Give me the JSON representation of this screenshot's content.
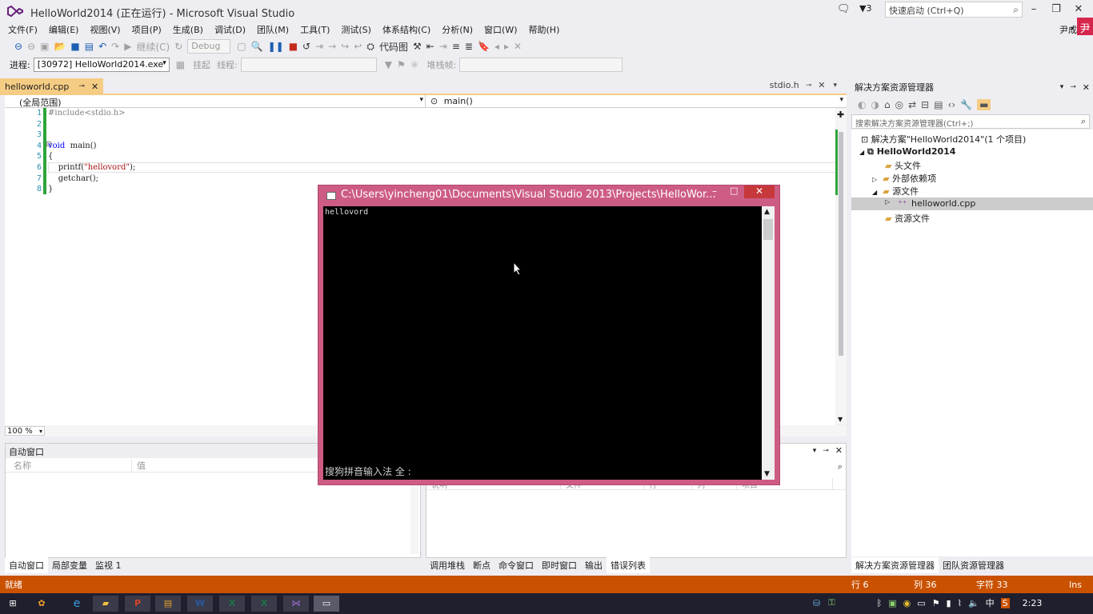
{
  "window": {
    "title": "HelloWorld2014 (正在运行) - Microsoft Visual Studio",
    "notification_count": "3",
    "quick_launch_placeholder": "快速启动 (Ctrl+Q)",
    "user_name": "尹成",
    "user_avatar": "尹"
  },
  "menu": [
    "文件(F)",
    "编辑(E)",
    "视图(V)",
    "项目(P)",
    "生成(B)",
    "调试(D)",
    "团队(M)",
    "工具(T)",
    "测试(S)",
    "体系结构(C)",
    "分析(N)",
    "窗口(W)",
    "帮助(H)"
  ],
  "toolbar1": {
    "continue_label": "继续(C)",
    "config": "Debug",
    "code_map_label": "代码图"
  },
  "toolbar2": {
    "process_label": "进程:",
    "process_value": "[30972] HelloWorld2014.exe",
    "suspend_label": "挂起",
    "thread_label": "线程:",
    "stack_label": "堆栈帧:"
  },
  "editor": {
    "active_tab": "helloworld.cpp",
    "other_tab": "stdio.h",
    "scope": "(全局范围)",
    "function": "main()",
    "zoom": "100 %",
    "line_numbers": [
      "1",
      "2",
      "3",
      "4",
      "5",
      "6",
      "7",
      "8"
    ],
    "lines": [
      {
        "parts": [
          {
            "t": "#include<stdio.h>",
            "c": "pp"
          }
        ]
      },
      {
        "parts": []
      },
      {
        "parts": []
      },
      {
        "parts": [
          {
            "t": "void",
            "c": "kw"
          },
          {
            "t": "  main()",
            "c": ""
          }
        ]
      },
      {
        "parts": [
          {
            "t": "{",
            "c": ""
          }
        ]
      },
      {
        "parts": [
          {
            "t": "    printf(",
            "c": ""
          },
          {
            "t": "\"hellovord\"",
            "c": "str"
          },
          {
            "t": ");",
            "c": ""
          }
        ]
      },
      {
        "parts": [
          {
            "t": "    getchar();",
            "c": ""
          }
        ]
      },
      {
        "parts": [
          {
            "t": "}",
            "c": ""
          }
        ]
      }
    ]
  },
  "auto_window": {
    "title": "自动窗口",
    "col_name": "名称",
    "col_value": "值",
    "tabs": [
      "自动窗口",
      "局部变量",
      "监视 1"
    ]
  },
  "error_list": {
    "columns": [
      "说明",
      "文件",
      "行",
      "列",
      "项目"
    ],
    "tabs": [
      "调用堆栈",
      "断点",
      "命令窗口",
      "即时窗口",
      "输出",
      "错误列表"
    ]
  },
  "solution_explorer": {
    "title": "解决方案资源管理器",
    "search_placeholder": "搜索解决方案资源管理器(Ctrl+;)",
    "solution": "解决方案\"HelloWorld2014\"(1 个项目)",
    "project": "HelloWorld2014",
    "folders": [
      "头文件",
      "外部依赖项",
      "源文件"
    ],
    "file": "helloworld.cpp",
    "resource_folder": "资源文件",
    "tabs": [
      "解决方案资源管理器",
      "团队资源管理器"
    ]
  },
  "status": {
    "ready": "就绪",
    "line": "行 6",
    "col": "列 36",
    "char": "字符 33",
    "mode": "Ins"
  },
  "console": {
    "title": "C:\\Users\\yincheng01\\Documents\\Visual Studio 2013\\Projects\\HelloWor...",
    "output": "hellovord",
    "ime": "搜狗拼音输入法 全 :"
  },
  "taskbar": {
    "clock": "2:23",
    "ime_indicator": "中"
  },
  "colors": {
    "accent": "#ca5100",
    "tab_active": "#f5cc84",
    "console_frame": "#cd5c84",
    "taskbar": "#1f1f2e"
  }
}
